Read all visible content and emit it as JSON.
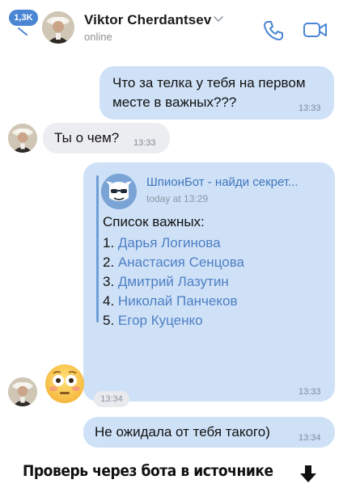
{
  "header": {
    "back_badge": "1,3K",
    "contact_name": "Viktor Cherdantsev",
    "status": "online",
    "icons": [
      "back-chevron-icon",
      "chevron-down-icon",
      "phone-icon",
      "video-camera-icon"
    ]
  },
  "messages": [
    {
      "direction": "out",
      "text_line1": "Что за телка у тебя на первом",
      "text_line2": "месте в важных???",
      "time": "13:33"
    },
    {
      "direction": "in",
      "text": "Ты о чем?",
      "time": "13:33"
    },
    {
      "direction": "out",
      "forwarded": {
        "sender": "ШпионБот - найди секрет...",
        "date": "today at 13:29",
        "title": "Список важных:",
        "items": [
          {
            "num": "1.",
            "name": "Дарья Логинова"
          },
          {
            "num": "2.",
            "name": "Анастасия Сенцова"
          },
          {
            "num": "3.",
            "name": "Дмитрий Лазутин"
          },
          {
            "num": "4.",
            "name": "Николай Панчеков"
          },
          {
            "num": "5.",
            "name": "Егор Куценко"
          }
        ]
      },
      "time": "13:33"
    },
    {
      "direction": "in",
      "emoji": "flushed-face-emoji",
      "time": "13:34"
    },
    {
      "direction": "out",
      "text": "Не ожидала от тебя такого)",
      "time": "13:34"
    }
  ],
  "footer": {
    "caption": "Проверь через бота в источнике",
    "icon": "arrow-down-icon"
  },
  "colors": {
    "outgoing_bubble": "#cfe1f7",
    "incoming_bubble": "#ecedf0",
    "accent": "#4a86d4",
    "link": "#4d7fc4"
  }
}
